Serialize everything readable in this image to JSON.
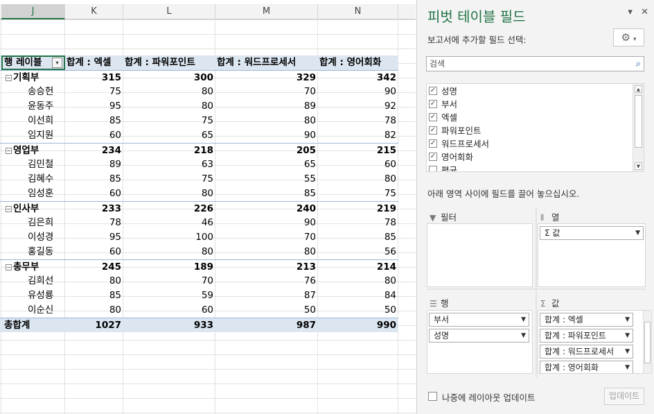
{
  "sheet": {
    "columns": [
      "J",
      "K",
      "L",
      "M",
      "N"
    ],
    "selected_column": "J",
    "pivot": {
      "headers": [
        "행 레이블",
        "합계 : 엑셀",
        "합계 : 파워포인트",
        "합계 : 워드프로세서",
        "합계 : 영어회화"
      ],
      "collapse_symbol": "⊟",
      "groups": [
        {
          "name": "기획부",
          "totals": [
            "315",
            "300",
            "329",
            "342"
          ],
          "rows": [
            {
              "name": "송승헌",
              "values": [
                "75",
                "80",
                "70",
                "90"
              ]
            },
            {
              "name": "윤동주",
              "values": [
                "95",
                "80",
                "89",
                "92"
              ]
            },
            {
              "name": "이선희",
              "values": [
                "85",
                "75",
                "80",
                "78"
              ]
            },
            {
              "name": "임지원",
              "values": [
                "60",
                "65",
                "90",
                "82"
              ]
            }
          ]
        },
        {
          "name": "영업부",
          "totals": [
            "234",
            "218",
            "205",
            "215"
          ],
          "rows": [
            {
              "name": "김민철",
              "values": [
                "89",
                "63",
                "65",
                "60"
              ]
            },
            {
              "name": "김혜수",
              "values": [
                "85",
                "75",
                "55",
                "80"
              ]
            },
            {
              "name": "임성훈",
              "values": [
                "60",
                "80",
                "85",
                "75"
              ]
            }
          ]
        },
        {
          "name": "인사부",
          "totals": [
            "233",
            "226",
            "240",
            "219"
          ],
          "rows": [
            {
              "name": "김은희",
              "values": [
                "78",
                "46",
                "90",
                "78"
              ]
            },
            {
              "name": "이성경",
              "values": [
                "95",
                "100",
                "70",
                "85"
              ]
            },
            {
              "name": "홍길동",
              "values": [
                "60",
                "80",
                "80",
                "56"
              ]
            }
          ]
        },
        {
          "name": "총무부",
          "totals": [
            "245",
            "189",
            "213",
            "214"
          ],
          "rows": [
            {
              "name": "김희선",
              "values": [
                "80",
                "70",
                "76",
                "80"
              ]
            },
            {
              "name": "유성룡",
              "values": [
                "85",
                "59",
                "87",
                "84"
              ]
            },
            {
              "name": "이순신",
              "values": [
                "80",
                "60",
                "50",
                "50"
              ]
            }
          ]
        }
      ],
      "grand_total": {
        "label": "총합계",
        "values": [
          "1027",
          "933",
          "987",
          "990"
        ]
      }
    }
  },
  "panel": {
    "title": "피벗 테이블 필드",
    "dropdown_icon": "▾",
    "close_icon": "✕",
    "choose_label": "보고서에 추가할 필드 선택:",
    "gear_icon": "gear-icon",
    "search_placeholder": "검색",
    "fields": [
      {
        "label": "성명",
        "checked": true
      },
      {
        "label": "부서",
        "checked": true
      },
      {
        "label": "엑셀",
        "checked": true
      },
      {
        "label": "파워포인트",
        "checked": true
      },
      {
        "label": "워드프로세서",
        "checked": true
      },
      {
        "label": "영어회화",
        "checked": true
      },
      {
        "label": "평균",
        "checked": false
      }
    ],
    "drag_label": "아래 영역 사이에 필드를 끌어 놓으십시오.",
    "areas": {
      "filter": {
        "title": "필터",
        "items": []
      },
      "columns": {
        "title": "열",
        "items": [
          "Σ 값"
        ]
      },
      "rows": {
        "title": "행",
        "items": [
          "부서",
          "성명"
        ]
      },
      "values": {
        "title": "값",
        "items": [
          "합계 : 엑셀",
          "합계 : 파워포인트",
          "합계 : 워드프로세서",
          "합계 : 영어회화"
        ]
      }
    },
    "defer_label": "나중에 레이아웃 업데이트",
    "update_label": "업데이트"
  }
}
